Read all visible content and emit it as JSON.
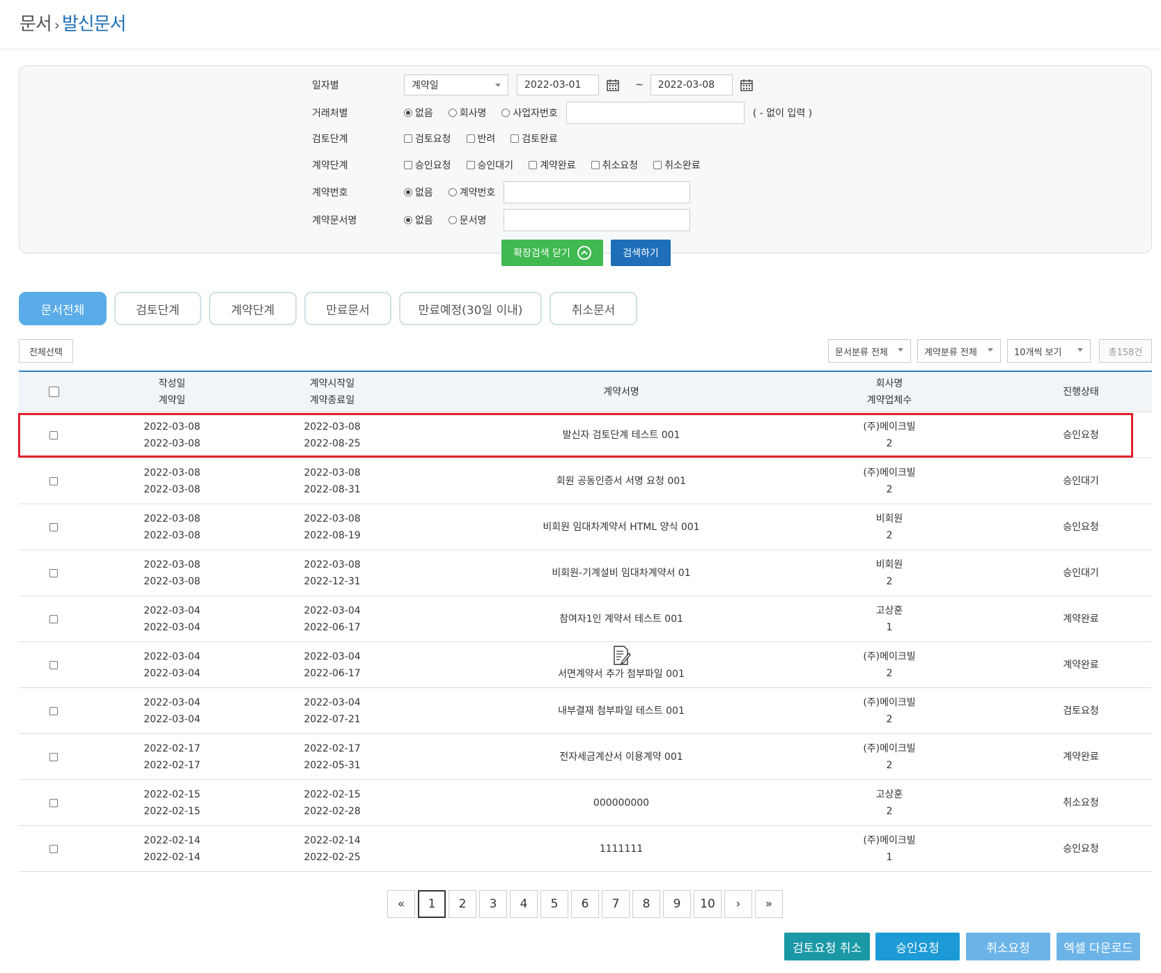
{
  "breadcrumb": {
    "parent": "문서",
    "separator": "›",
    "current": "발신문서"
  },
  "search": {
    "date_label": "일자별",
    "date_type_value": "계약일",
    "date_from": "2022-03-01",
    "date_sep": "~",
    "date_to": "2022-03-08",
    "partner_label": "거래처별",
    "partner_options": [
      "없음",
      "회사명",
      "사업자번호"
    ],
    "partner_hint": "( - 없이 입력 )",
    "review_label": "검토단계",
    "review_options": [
      "검토요청",
      "반려",
      "검토완료"
    ],
    "contract_label": "계약단계",
    "contract_options": [
      "승인요청",
      "승인대기",
      "계약완료",
      "취소요청",
      "취소완료"
    ],
    "number_label": "계약번호",
    "number_options": [
      "없음",
      "계약번호"
    ],
    "docname_label": "계약문서명",
    "docname_options": [
      "없음",
      "문서명"
    ],
    "expand_label": "확장검색 닫기",
    "search_label": "검색하기"
  },
  "tabs": [
    "문서전체",
    "검토단계",
    "계약단계",
    "만료문서",
    "만료예정(30일 이내)",
    "취소문서"
  ],
  "toolbar": {
    "select_all": "전체선택",
    "doc_filter": "문서분류 전체",
    "contract_filter": "계약분류 전체",
    "page_size": "10개씩 보기",
    "total": "총158건"
  },
  "table": {
    "headers": {
      "created": "작성일",
      "contract_date": "계약일",
      "start": "계약시작일",
      "end": "계약종료일",
      "title": "계약서명",
      "company": "회사명",
      "company_count": "계약업체수",
      "status": "진행상태"
    },
    "rows": [
      {
        "created": "2022-03-08",
        "contract": "2022-03-08",
        "start": "2022-03-08",
        "end": "2022-08-25",
        "title": "발신자 검토단계 테스트 001",
        "company": "(주)메이크빌",
        "count": "2",
        "status": "승인요청"
      },
      {
        "created": "2022-03-08",
        "contract": "2022-03-08",
        "start": "2022-03-08",
        "end": "2022-08-31",
        "title": "회원 공동인증서 서명 요청 001",
        "company": "(주)메이크빌",
        "count": "2",
        "status": "승인대기"
      },
      {
        "created": "2022-03-08",
        "contract": "2022-03-08",
        "start": "2022-03-08",
        "end": "2022-08-19",
        "title": "비회원 임대차계약서 HTML 양식 001",
        "company": "비회원",
        "count": "2",
        "status": "승인요청"
      },
      {
        "created": "2022-03-08",
        "contract": "2022-03-08",
        "start": "2022-03-08",
        "end": "2022-12-31",
        "title": "비회원-기계설비 임대차계약서 01",
        "company": "비회원",
        "count": "2",
        "status": "승인대기"
      },
      {
        "created": "2022-03-04",
        "contract": "2022-03-04",
        "start": "2022-03-04",
        "end": "2022-06-17",
        "title": "참여자1인 계약서 테스트 001",
        "company": "고상훈",
        "count": "1",
        "status": "계약완료"
      },
      {
        "created": "2022-03-04",
        "contract": "2022-03-04",
        "start": "2022-03-04",
        "end": "2022-06-17",
        "title": "서면계약서 추가 첨부파일 001",
        "company": "(주)메이크빌",
        "count": "2",
        "status": "계약완료",
        "icon": "document-edit-icon"
      },
      {
        "created": "2022-03-04",
        "contract": "2022-03-04",
        "start": "2022-03-04",
        "end": "2022-07-21",
        "title": "내부결재 첨부파일 테스트 001",
        "company": "(주)메이크빌",
        "count": "2",
        "status": "검토요청"
      },
      {
        "created": "2022-02-17",
        "contract": "2022-02-17",
        "start": "2022-02-17",
        "end": "2022-05-31",
        "title": "전자세금계산서 이용계약 001",
        "company": "(주)메이크빌",
        "count": "2",
        "status": "계약완료"
      },
      {
        "created": "2022-02-15",
        "contract": "2022-02-15",
        "start": "2022-02-15",
        "end": "2022-02-28",
        "title": "000000000",
        "company": "고상훈",
        "count": "2",
        "status": "취소요청"
      },
      {
        "created": "2022-02-14",
        "contract": "2022-02-14",
        "start": "2022-02-14",
        "end": "2022-02-25",
        "title": "1111111",
        "company": "(주)메이크빌",
        "count": "1",
        "status": "승인요청"
      }
    ]
  },
  "pagination": {
    "first": "«",
    "prev": "‹",
    "pages": [
      "1",
      "2",
      "3",
      "4",
      "5",
      "6",
      "7",
      "8",
      "9",
      "10"
    ],
    "current": "1",
    "next": "›",
    "last": "»"
  },
  "actions": [
    {
      "label": "검토요청 취소",
      "color": "#1a98a6"
    },
    {
      "label": "승인요청",
      "color": "#1c9ad6"
    },
    {
      "label": "취소요청",
      "color": "#6cb4e8"
    },
    {
      "label": "엑셀 다운로드",
      "color": "#6cb4e8"
    }
  ],
  "colors": {
    "accent": "#1e6fb8",
    "expand_button": "#3fb950",
    "active_tab": "#5aace8",
    "highlight_border": "#e0202a"
  }
}
